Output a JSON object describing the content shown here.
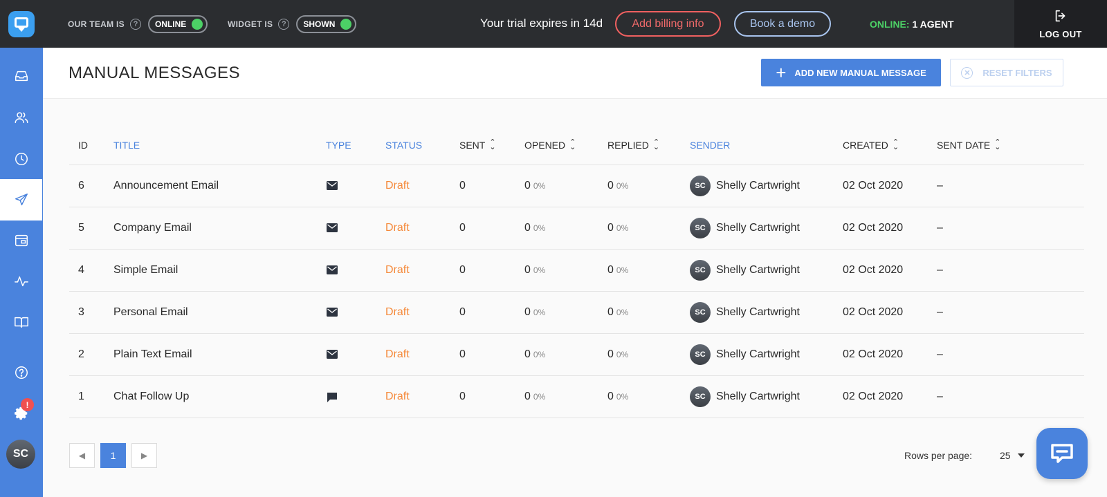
{
  "topbar": {
    "team_label": "OUR TEAM IS",
    "team_status": "ONLINE",
    "widget_label": "WIDGET IS",
    "widget_status": "SHOWN",
    "trial_text": "Your trial expires in 14d",
    "billing_btn": "Add billing info",
    "demo_btn": "Book a demo",
    "online_label": "ONLINE:",
    "agents_label": "1 AGENT",
    "logout_label": "LOG OUT"
  },
  "sidebar": {
    "items": [
      "inbox-icon",
      "users-icon",
      "clock-icon",
      "send-icon",
      "widget-icon",
      "activity-icon",
      "book-icon",
      "help-icon",
      "gear-icon"
    ],
    "settings_badge": "!",
    "avatar_initials": "SC"
  },
  "header": {
    "title": "MANUAL MESSAGES",
    "add_btn": "ADD NEW MANUAL MESSAGE",
    "reset_btn": "RESET FILTERS"
  },
  "table": {
    "columns": {
      "id": "ID",
      "title": "TITLE",
      "type": "TYPE",
      "status": "STATUS",
      "sent": "SENT",
      "opened": "OPENED",
      "replied": "REPLIED",
      "sender": "SENDER",
      "created": "CREATED",
      "sent_date": "SENT DATE"
    },
    "rows": [
      {
        "id": "6",
        "title": "Announcement Email",
        "type": "email",
        "status": "Draft",
        "sent": "0",
        "opened": "0",
        "opened_pct": "0%",
        "replied": "0",
        "replied_pct": "0%",
        "sender_initials": "SC",
        "sender": "Shelly Cartwright",
        "created": "02 Oct 2020",
        "sent_date": "–"
      },
      {
        "id": "5",
        "title": "Company Email",
        "type": "email",
        "status": "Draft",
        "sent": "0",
        "opened": "0",
        "opened_pct": "0%",
        "replied": "0",
        "replied_pct": "0%",
        "sender_initials": "SC",
        "sender": "Shelly Cartwright",
        "created": "02 Oct 2020",
        "sent_date": "–"
      },
      {
        "id": "4",
        "title": "Simple Email",
        "type": "email",
        "status": "Draft",
        "sent": "0",
        "opened": "0",
        "opened_pct": "0%",
        "replied": "0",
        "replied_pct": "0%",
        "sender_initials": "SC",
        "sender": "Shelly Cartwright",
        "created": "02 Oct 2020",
        "sent_date": "–"
      },
      {
        "id": "3",
        "title": "Personal Email",
        "type": "email",
        "status": "Draft",
        "sent": "0",
        "opened": "0",
        "opened_pct": "0%",
        "replied": "0",
        "replied_pct": "0%",
        "sender_initials": "SC",
        "sender": "Shelly Cartwright",
        "created": "02 Oct 2020",
        "sent_date": "–"
      },
      {
        "id": "2",
        "title": "Plain Text Email",
        "type": "email",
        "status": "Draft",
        "sent": "0",
        "opened": "0",
        "opened_pct": "0%",
        "replied": "0",
        "replied_pct": "0%",
        "sender_initials": "SC",
        "sender": "Shelly Cartwright",
        "created": "02 Oct 2020",
        "sent_date": "–"
      },
      {
        "id": "1",
        "title": "Chat Follow Up",
        "type": "chat",
        "status": "Draft",
        "sent": "0",
        "opened": "0",
        "opened_pct": "0%",
        "replied": "0",
        "replied_pct": "0%",
        "sender_initials": "SC",
        "sender": "Shelly Cartwright",
        "created": "02 Oct 2020",
        "sent_date": "–"
      }
    ]
  },
  "pagination": {
    "current_page": "1",
    "rows_per_page_label": "Rows per page:",
    "rows_per_page": "25"
  },
  "colors": {
    "accent": "#4a83dd",
    "topbar": "#2b2d30",
    "draft": "#f5893a",
    "online": "#4cd166",
    "billing": "#f06060"
  }
}
